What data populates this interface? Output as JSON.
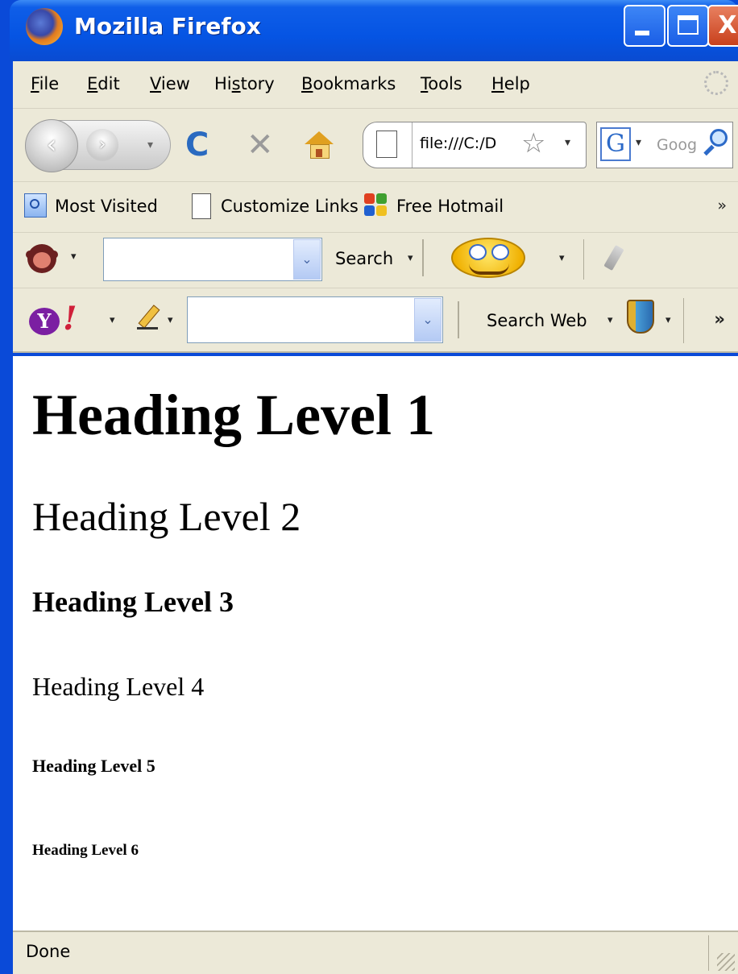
{
  "window": {
    "title": "Mozilla Firefox",
    "controls": {
      "minimize": "_",
      "maximize": "□",
      "close": "X"
    }
  },
  "menubar": {
    "items": [
      {
        "label": "File",
        "accesskey_index": 0
      },
      {
        "label": "Edit",
        "accesskey_index": 0
      },
      {
        "label": "View",
        "accesskey_index": 0
      },
      {
        "label": "History",
        "accesskey_index": 2
      },
      {
        "label": "Bookmarks",
        "accesskey_index": 0
      },
      {
        "label": "Tools",
        "accesskey_index": 0
      },
      {
        "label": "Help",
        "accesskey_index": 0
      }
    ]
  },
  "navbar": {
    "back_icon": "‹",
    "forward_icon": "›",
    "history_dropdown": "▾",
    "reload_icon": "C",
    "stop_icon": "✕",
    "url": "file:///C:/D",
    "bookmark_star": "☆",
    "url_dropdown": "▾",
    "search_engine_icon": "G",
    "search_dropdown": "▾",
    "search_placeholder": "Goog"
  },
  "bookmarks": {
    "items": [
      {
        "label": "Most Visited"
      },
      {
        "label": "Customize Links"
      },
      {
        "label": "Free Hotmail"
      }
    ],
    "overflow": "»"
  },
  "toolbar1": {
    "dropdown": "▾",
    "combo_arrow": "⌄",
    "search_label": "Search",
    "search_dropdown": "▾",
    "smiley_dropdown": "▾"
  },
  "toolbar2": {
    "yahoo_y": "Y",
    "yahoo_bang": "!",
    "dropdown": "▾",
    "combo_arrow": "⌄",
    "search_web_label": "Search Web",
    "overflow": "»"
  },
  "content": {
    "headings": {
      "h1": "Heading Level 1",
      "h2": "Heading Level 2",
      "h3": "Heading Level 3",
      "h4": "Heading Level 4",
      "h5": "Heading Level 5",
      "h6": "Heading Level 6"
    }
  },
  "statusbar": {
    "text": "Done"
  },
  "colors": {
    "titlebar": "#0554e3",
    "chrome": "#ece9d8",
    "close_button": "#c8401c",
    "frame": "#0a4ad8"
  }
}
